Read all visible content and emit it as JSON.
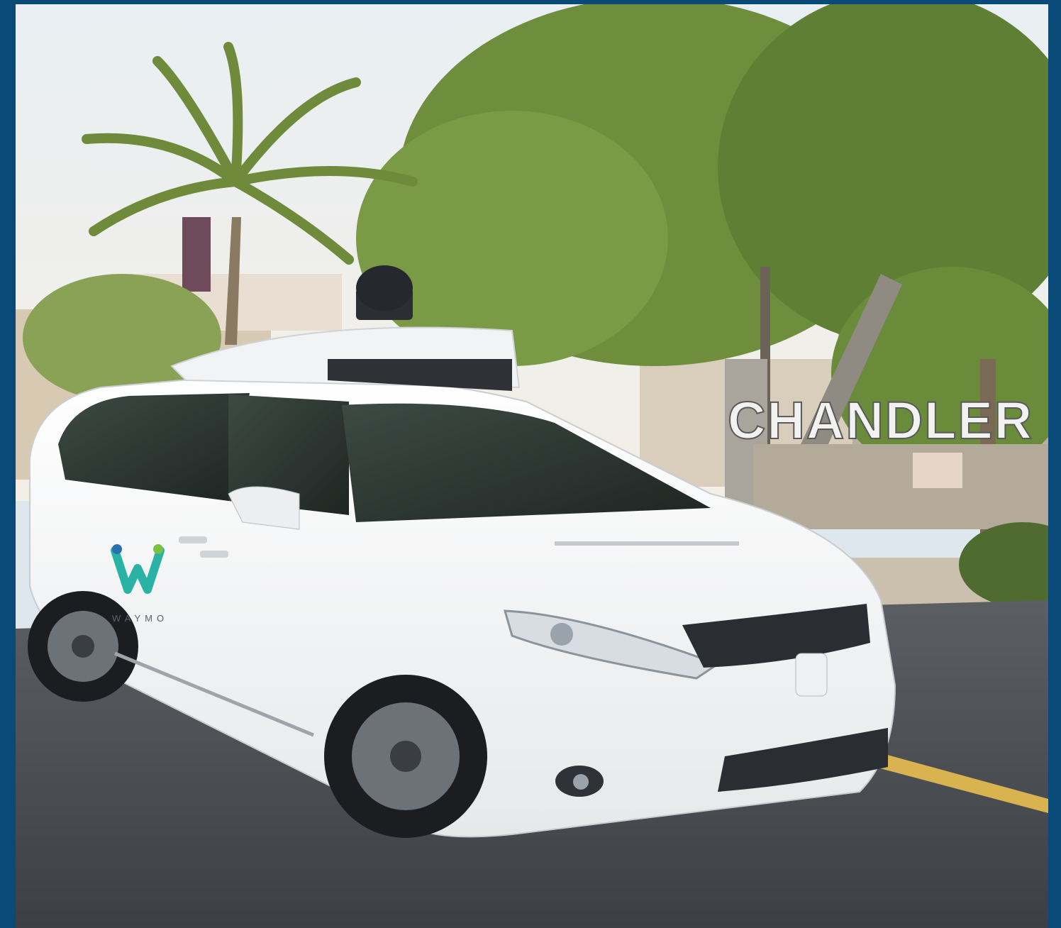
{
  "photo": {
    "sign_text": "CHANDLER C",
    "door_logo_text": "WAYMO",
    "colors": {
      "frame": "#0a4a78",
      "car_body": "#f6f7f8",
      "waymo_teal": "#2ab3a5",
      "waymo_blue": "#2a6fb0",
      "road": "#4a4d52",
      "foliage": "#6e8f3c"
    }
  }
}
